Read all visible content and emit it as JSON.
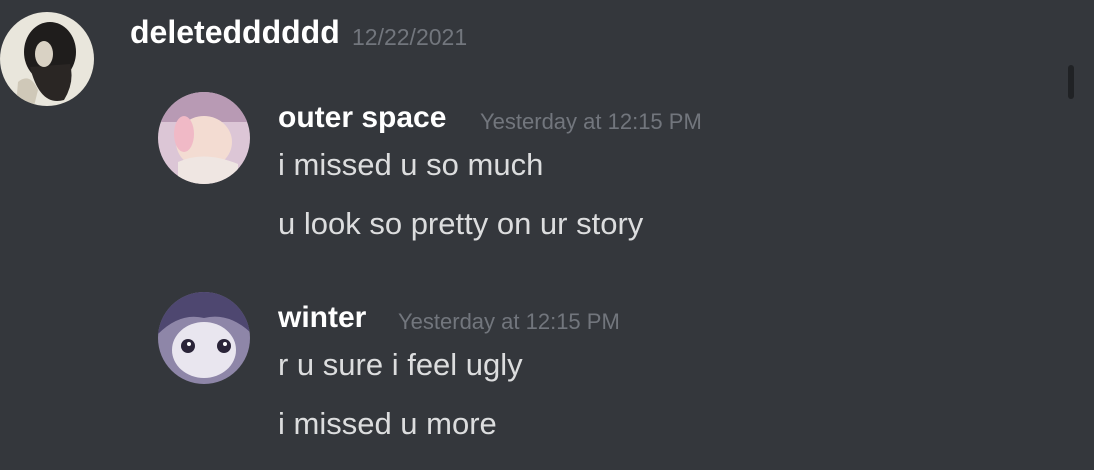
{
  "messages": [
    {
      "author": "deletedddddd",
      "timestamp": "12/22/2021",
      "avatar_icon": "user-avatar-icon",
      "lines": []
    },
    {
      "author": "outer space",
      "timestamp": "Yesterday at 12:15 PM",
      "avatar_icon": "user-avatar-icon",
      "lines": [
        "i missed u so much",
        "u look so pretty on ur story"
      ]
    },
    {
      "author": "winter",
      "timestamp": "Yesterday at 12:15 PM",
      "avatar_icon": "user-avatar-icon",
      "lines": [
        "r u sure i feel ugly",
        "i missed u more"
      ]
    }
  ],
  "colors": {
    "background": "#34373c",
    "username": "#ffffff",
    "timestamp": "#72767d",
    "message_text": "#dcddde"
  }
}
